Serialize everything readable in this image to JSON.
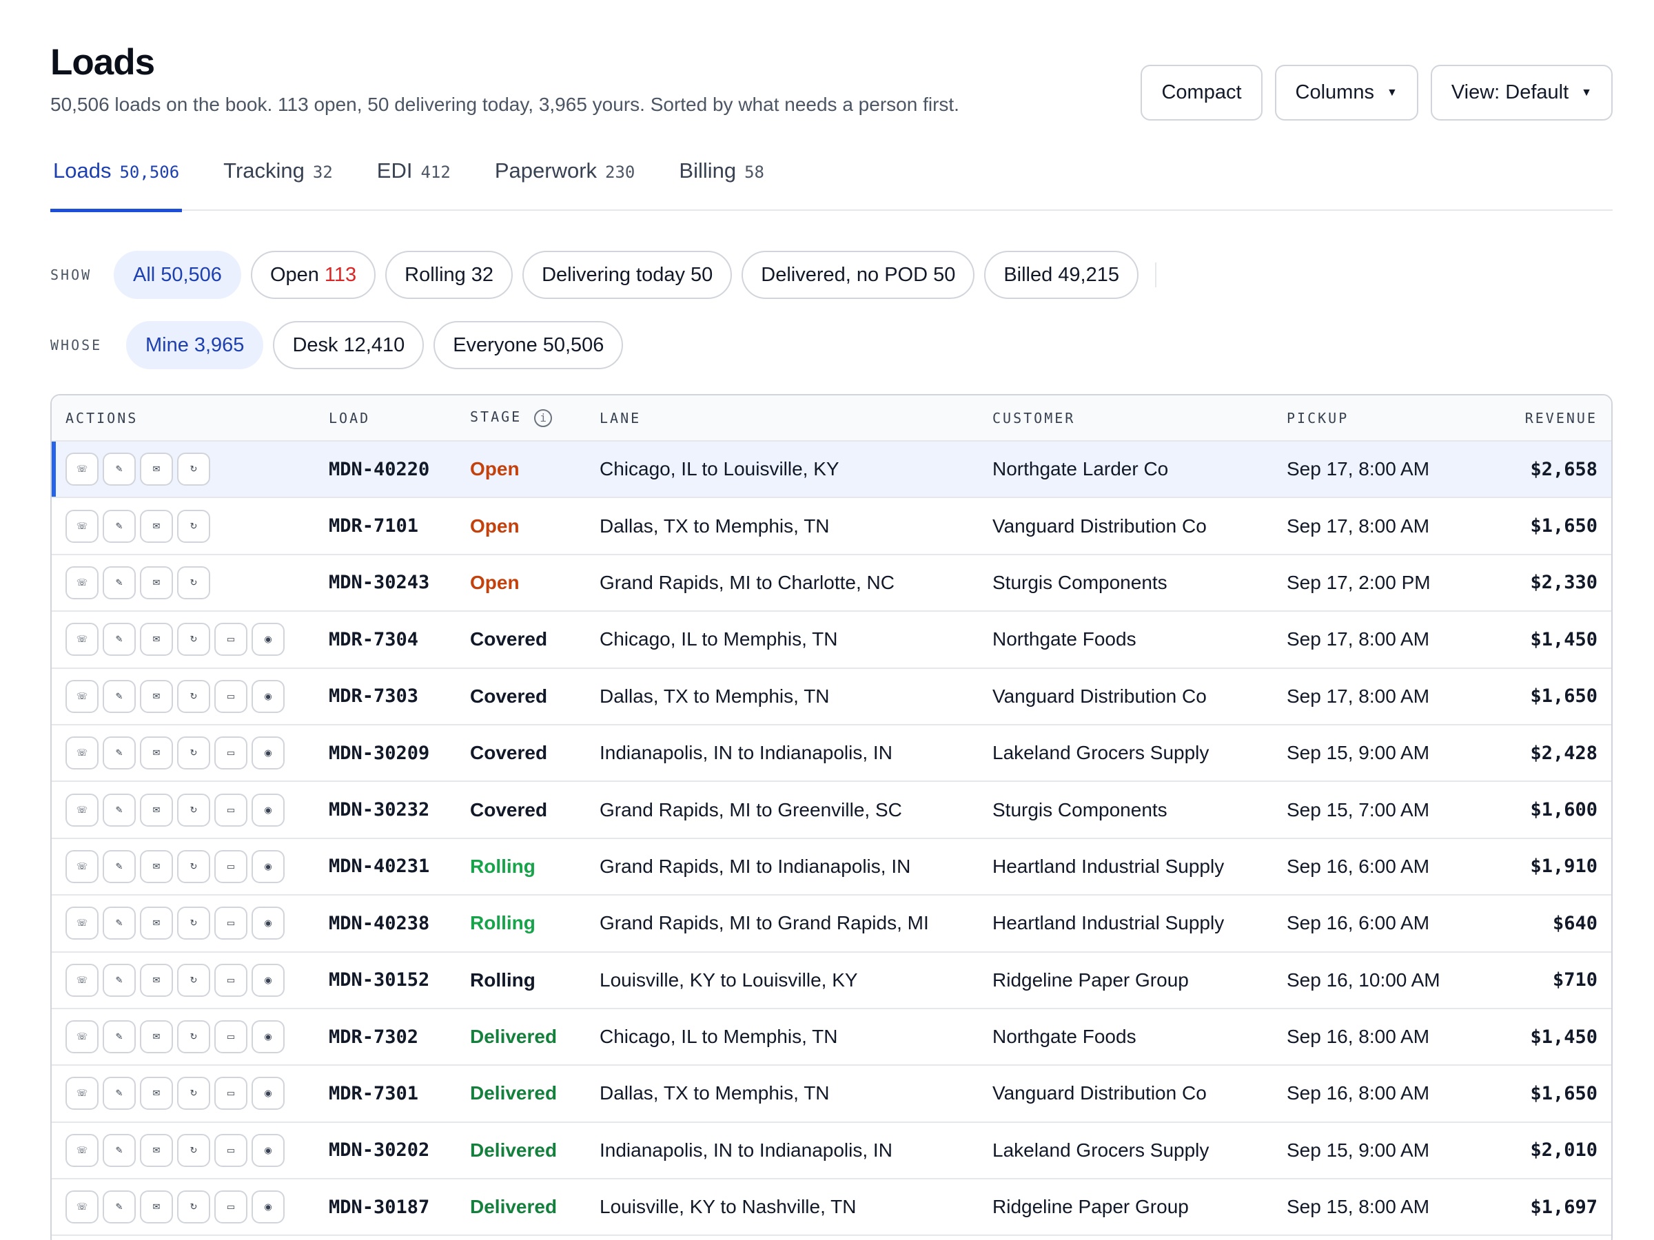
{
  "header": {
    "title": "Loads",
    "subtitle": "50,506 loads on the book. 113 open, 50 delivering today, 3,965 yours. Sorted by what needs a person first."
  },
  "top_actions": {
    "compact": "Compact",
    "columns": "Columns",
    "view": "View: Default"
  },
  "tabs": [
    {
      "label": "Loads",
      "count": "50,506"
    },
    {
      "label": "Tracking",
      "count": "32"
    },
    {
      "label": "EDI",
      "count": "412"
    },
    {
      "label": "Paperwork",
      "count": "230"
    },
    {
      "label": "Billing",
      "count": "58"
    }
  ],
  "filters": {
    "show_label": "SHOW",
    "show": [
      {
        "label": "All",
        "count": "50,506"
      },
      {
        "label": "Open",
        "count": "113"
      },
      {
        "label": "Rolling",
        "count": "32"
      },
      {
        "label": "Delivering today",
        "count": "50"
      },
      {
        "label": "Delivered, no POD",
        "count": "50"
      },
      {
        "label": "Billed",
        "count": "49,215"
      }
    ],
    "whose_label": "WHOSE",
    "whose": [
      {
        "label": "Mine",
        "count": "3,965"
      },
      {
        "label": "Desk",
        "count": "12,410"
      },
      {
        "label": "Everyone",
        "count": "50,506"
      }
    ]
  },
  "table": {
    "columns": {
      "actions": "ACTIONS",
      "load": "LOAD",
      "stage": "STAGE",
      "lane": "LANE",
      "customer": "CUSTOMER",
      "pickup": "PICKUP",
      "revenue": "REVENUE"
    },
    "rows": [
      {
        "load": "MDN-40220",
        "stage": "Open",
        "lane": "Chicago, IL to Louisville, KY",
        "customer": "Northgate Larder Co",
        "pickup": "Sep 17, 8:00 AM",
        "revenue": "$2,658"
      },
      {
        "load": "MDR-7101",
        "stage": "Open",
        "lane": "Dallas, TX to Memphis, TN",
        "customer": "Vanguard Distribution Co",
        "pickup": "Sep 17, 8:00 AM",
        "revenue": "$1,650"
      },
      {
        "load": "MDN-30243",
        "stage": "Open",
        "lane": "Grand Rapids, MI to Charlotte, NC",
        "customer": "Sturgis Components",
        "pickup": "Sep 17, 2:00 PM",
        "revenue": "$2,330"
      },
      {
        "load": "MDR-7304",
        "stage": "Covered",
        "lane": "Chicago, IL to Memphis, TN",
        "customer": "Northgate Foods",
        "pickup": "Sep 17, 8:00 AM",
        "revenue": "$1,450"
      },
      {
        "load": "MDR-7303",
        "stage": "Covered",
        "lane": "Dallas, TX to Memphis, TN",
        "customer": "Vanguard Distribution Co",
        "pickup": "Sep 17, 8:00 AM",
        "revenue": "$1,650"
      },
      {
        "load": "MDN-30209",
        "stage": "Covered",
        "lane": "Indianapolis, IN to Indianapolis, IN",
        "customer": "Lakeland Grocers Supply",
        "pickup": "Sep 15, 9:00 AM",
        "revenue": "$2,428"
      },
      {
        "load": "MDN-30232",
        "stage": "Covered",
        "lane": "Grand Rapids, MI to Greenville, SC",
        "customer": "Sturgis Components",
        "pickup": "Sep 15, 7:00 AM",
        "revenue": "$1,600"
      },
      {
        "load": "MDN-40231",
        "stage": "Rolling",
        "lane": "Grand Rapids, MI to Indianapolis, IN",
        "customer": "Heartland Industrial Supply",
        "pickup": "Sep 16, 6:00 AM",
        "revenue": "$1,910"
      },
      {
        "load": "MDN-40238",
        "stage": "Rolling",
        "lane": "Grand Rapids, MI to Grand Rapids, MI",
        "customer": "Heartland Industrial Supply",
        "pickup": "Sep 16, 6:00 AM",
        "revenue": "$640"
      },
      {
        "load": "MDN-30152",
        "stage": "Rolling",
        "lane": "Louisville, KY to Louisville, KY",
        "customer": "Ridgeline Paper Group",
        "pickup": "Sep 16, 10:00 AM",
        "revenue": "$710"
      },
      {
        "load": "MDR-7302",
        "stage": "Delivered",
        "lane": "Chicago, IL to Memphis, TN",
        "customer": "Northgate Foods",
        "pickup": "Sep 16, 8:00 AM",
        "revenue": "$1,450"
      },
      {
        "load": "MDR-7301",
        "stage": "Delivered",
        "lane": "Dallas, TX to Memphis, TN",
        "customer": "Vanguard Distribution Co",
        "pickup": "Sep 16, 8:00 AM",
        "revenue": "$1,650"
      },
      {
        "load": "MDN-30202",
        "stage": "Delivered",
        "lane": "Indianapolis, IN to Indianapolis, IN",
        "customer": "Lakeland Grocers Supply",
        "pickup": "Sep 15, 9:00 AM",
        "revenue": "$2,010"
      },
      {
        "load": "MDN-30187",
        "stage": "Delivered",
        "lane": "Louisville, KY to Nashville, TN",
        "customer": "Ridgeline Paper Group",
        "pickup": "Sep 15, 8:00 AM",
        "revenue": "$1,697"
      }
    ]
  },
  "row_action_icons": [
    "phone-icon",
    "edit-icon",
    "mail-icon",
    "history-icon",
    "comment-icon",
    "location-icon"
  ],
  "colors": {
    "accent": "#1d4ed8",
    "stage_open": "#c2410c",
    "stage_rolling": "#16a34a",
    "stage_delivered": "#15803d",
    "open_count": "#dc2626"
  }
}
